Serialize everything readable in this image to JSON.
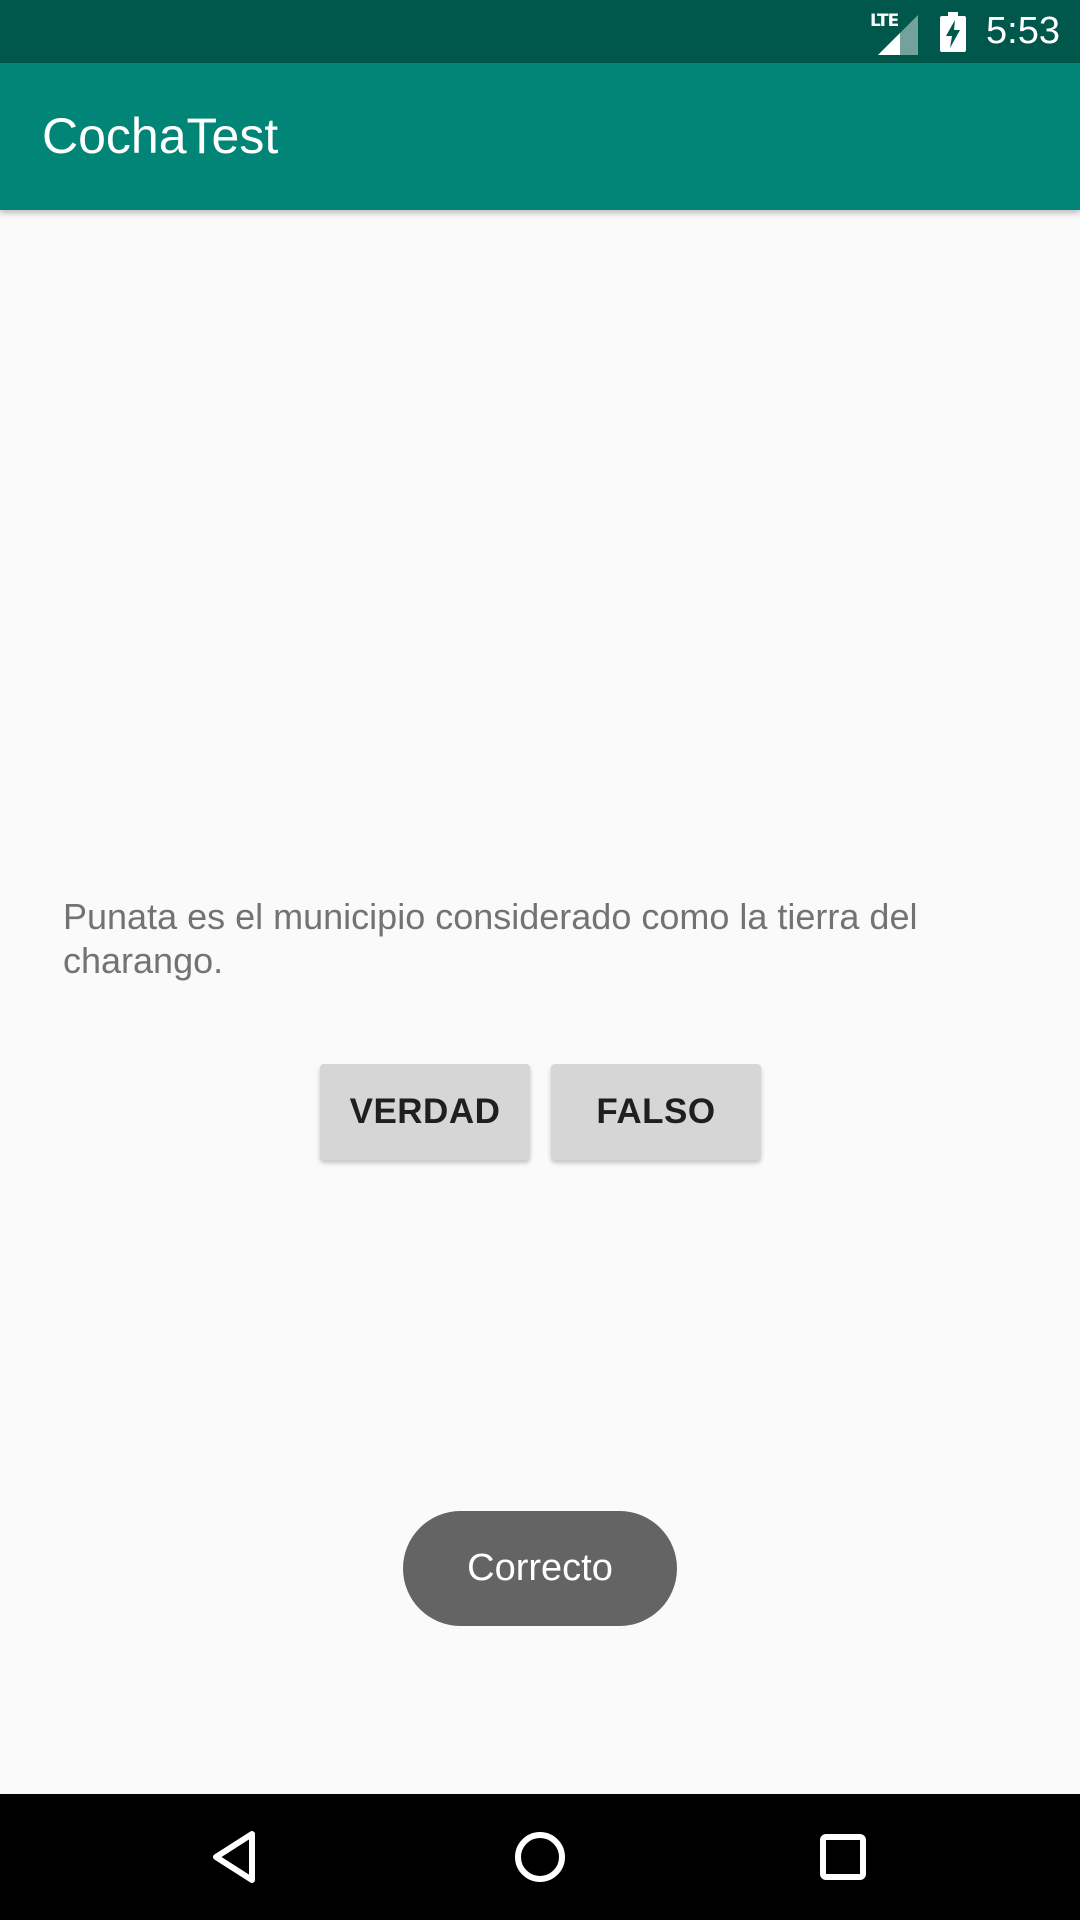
{
  "status_bar": {
    "network_label": "LTE",
    "time": "5:53",
    "icons": [
      "lte-signal-icon",
      "battery-charging-icon"
    ]
  },
  "app_bar": {
    "title": "CochaTest"
  },
  "quiz": {
    "question": "Punata es el municipio considerado como la tierra del charango.",
    "true_label": "VERDAD",
    "false_label": "FALSO"
  },
  "toast": {
    "message": "Correcto"
  },
  "nav_bar": {
    "icons": [
      "back-icon",
      "home-icon",
      "recent-apps-icon"
    ]
  },
  "colors": {
    "status_bar": "#00574b",
    "app_bar": "#008577",
    "background": "#fafafa",
    "button": "#d6d6d6",
    "toast": "#646464",
    "nav_bar": "#000000"
  }
}
